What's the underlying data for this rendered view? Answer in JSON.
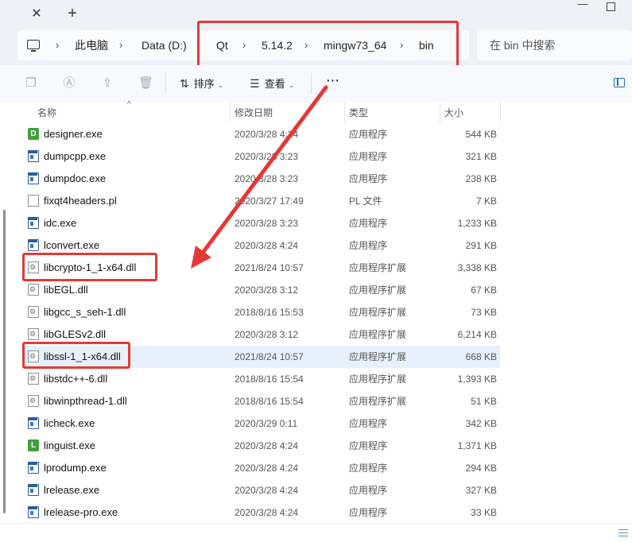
{
  "window": {
    "close_tab_glyph": "✕",
    "new_tab_glyph": "+",
    "minimize_glyph": "—"
  },
  "address_bar": {
    "breadcrumb": [
      "此电脑",
      "Data (D:)",
      "Qt",
      "5.14.2",
      "mingw73_64",
      "bin"
    ],
    "separator": "›"
  },
  "search": {
    "placeholder": "在 bin 中搜索"
  },
  "toolbar": {
    "sort_label": "排序",
    "view_label": "查看",
    "more_label": "···"
  },
  "columns": {
    "name": "名称",
    "modified": "修改日期",
    "type": "类型",
    "size": "大小"
  },
  "files": [
    {
      "name": "designer.exe",
      "date": "2020/3/28 4:24",
      "type": "应用程序",
      "size": "544 KB",
      "icon": "qt-designer-icon"
    },
    {
      "name": "dumpcpp.exe",
      "date": "2020/3/28 3:23",
      "type": "应用程序",
      "size": "321 KB",
      "icon": "exe-icon"
    },
    {
      "name": "dumpdoc.exe",
      "date": "2020/3/28 3:23",
      "type": "应用程序",
      "size": "238 KB",
      "icon": "exe-icon"
    },
    {
      "name": "fixqt4headers.pl",
      "date": "2020/3/27 17:49",
      "type": "PL 文件",
      "size": "7 KB",
      "icon": "document-icon"
    },
    {
      "name": "idc.exe",
      "date": "2020/3/28 3:23",
      "type": "应用程序",
      "size": "1,233 KB",
      "icon": "exe-icon"
    },
    {
      "name": "lconvert.exe",
      "date": "2020/3/28 4:24",
      "type": "应用程序",
      "size": "291 KB",
      "icon": "exe-icon"
    },
    {
      "name": "libcrypto-1_1-x64.dll",
      "date": "2021/8/24 10:57",
      "type": "应用程序扩展",
      "size": "3,338 KB",
      "icon": "dll-icon"
    },
    {
      "name": "libEGL.dll",
      "date": "2020/3/28 3:12",
      "type": "应用程序扩展",
      "size": "67 KB",
      "icon": "dll-icon"
    },
    {
      "name": "libgcc_s_seh-1.dll",
      "date": "2018/8/16 15:53",
      "type": "应用程序扩展",
      "size": "73 KB",
      "icon": "dll-icon"
    },
    {
      "name": "libGLESv2.dll",
      "date": "2020/3/28 3:12",
      "type": "应用程序扩展",
      "size": "6,214 KB",
      "icon": "dll-icon"
    },
    {
      "name": "libssl-1_1-x64.dll",
      "date": "2021/8/24 10:57",
      "type": "应用程序扩展",
      "size": "668 KB",
      "icon": "dll-icon"
    },
    {
      "name": "libstdc++-6.dll",
      "date": "2018/8/16 15:54",
      "type": "应用程序扩展",
      "size": "1,393 KB",
      "icon": "dll-icon"
    },
    {
      "name": "libwinpthread-1.dll",
      "date": "2018/8/16 15:54",
      "type": "应用程序扩展",
      "size": "51 KB",
      "icon": "dll-icon"
    },
    {
      "name": "licheck.exe",
      "date": "2020/3/29 0:11",
      "type": "应用程序",
      "size": "342 KB",
      "icon": "exe-icon"
    },
    {
      "name": "linguist.exe",
      "date": "2020/3/28 4:24",
      "type": "应用程序",
      "size": "1,371 KB",
      "icon": "qt-linguist-icon"
    },
    {
      "name": "lprodump.exe",
      "date": "2020/3/28 4:24",
      "type": "应用程序",
      "size": "294 KB",
      "icon": "exe-icon"
    },
    {
      "name": "lrelease.exe",
      "date": "2020/3/28 4:24",
      "type": "应用程序",
      "size": "327 KB",
      "icon": "exe-icon"
    },
    {
      "name": "lrelease-pro.exe",
      "date": "2020/3/28 4:24",
      "type": "应用程序",
      "size": "33 KB",
      "icon": "exe-icon"
    }
  ],
  "selected_file": "libssl-1_1-x64.dll",
  "annotation_color": "#e53935",
  "icon_glyphs": {
    "designer_letter": "D",
    "linguist_letter": "L"
  }
}
